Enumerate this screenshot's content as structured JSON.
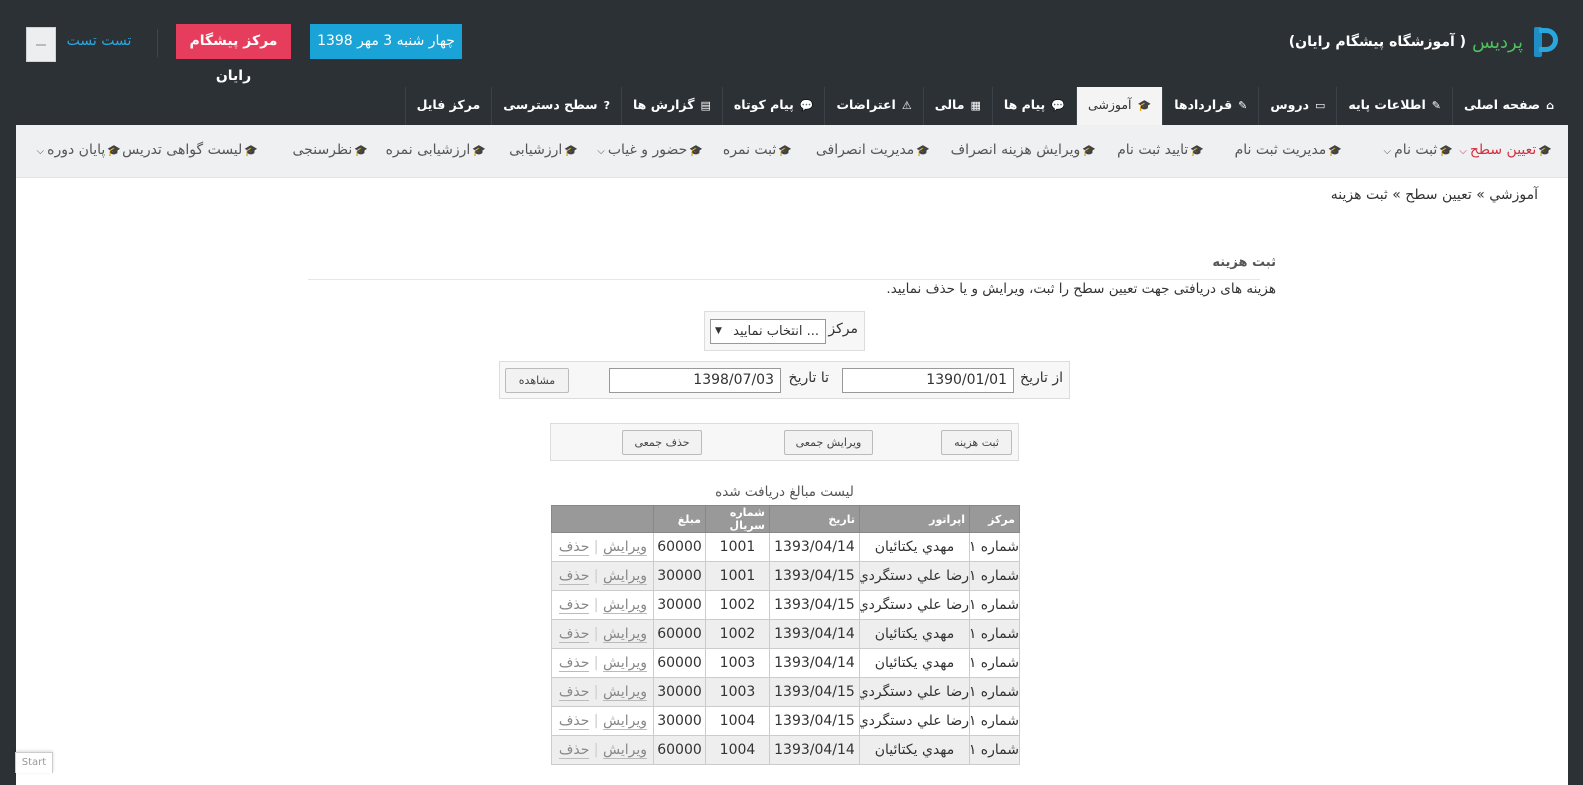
{
  "header": {
    "brand": "پردیس",
    "subtitle": "( آموزشگاه پیشگام رایان)",
    "date": "چهار شنبه 3 مهر 1398",
    "center": "مرکز پیشگام رایان",
    "user": "تست تست"
  },
  "main_tabs": [
    {
      "label": "صفحه اصلی",
      "icon": "home-icon",
      "glyph": "⌂"
    },
    {
      "label": "اطلاعات پایه",
      "icon": "wrench-icon",
      "glyph": "✎"
    },
    {
      "label": "دروس",
      "icon": "folder-icon",
      "glyph": "▭"
    },
    {
      "label": "قراردادها",
      "icon": "edit-icon",
      "glyph": "✎"
    },
    {
      "label": "آموزشی",
      "icon": "graduation-cap-icon",
      "glyph": "🎓"
    },
    {
      "label": "پیام ها",
      "icon": "comments-icon",
      "glyph": "💬"
    },
    {
      "label": "مالی",
      "icon": "calculator-icon",
      "glyph": "▦"
    },
    {
      "label": "اعتراضات",
      "icon": "warning-icon",
      "glyph": "⚠"
    },
    {
      "label": "پیام کوتاه",
      "icon": "comment-icon",
      "glyph": "💬"
    },
    {
      "label": "گزارش ها",
      "icon": "file-icon",
      "glyph": "▤"
    },
    {
      "label": "سطح دسترسی",
      "icon": "question-icon",
      "glyph": "?"
    },
    {
      "label": "مرکز فایل",
      "icon": "",
      "glyph": ""
    }
  ],
  "sub_menu": [
    {
      "label": "تعیین سطح",
      "current": true,
      "dropdown": true
    },
    {
      "label": "ثبت نام",
      "dropdown": true
    },
    {
      "label": "مدیریت ثبت نام"
    },
    {
      "label": "تایید ثبت نام"
    },
    {
      "label": "ویرایش هزینه انصراف"
    },
    {
      "label": "مدیریت انصرافی"
    },
    {
      "label": "ثبت نمره"
    },
    {
      "label": "حضور و غیاب",
      "dropdown": true
    },
    {
      "label": "ارزشیابی"
    },
    {
      "label": "ارزشیابی نمره"
    },
    {
      "label": "نظرسنجی"
    },
    {
      "label": "لیست گواهی تدریس"
    },
    {
      "label": "پایان دوره",
      "dropdown": true
    }
  ],
  "breadcrumb": "آموزشي » تعیین سطح » ثبت هزینه",
  "section": {
    "title": "ثبت هزینه",
    "description": "هزینه های دریافتی جهت تعیین سطح را ثبت، ویرایش و یا حذف نمایید."
  },
  "filter": {
    "center_label": "مرکز",
    "center_value": "انتخاب نمایید ...",
    "from_label": "از تاریخ",
    "from_value": "1390/01/01",
    "to_label": "تا تاریخ",
    "to_value": "1398/07/03",
    "view_button": "مشاهده"
  },
  "actions": {
    "add": "ثبت هزینه",
    "bulk_edit": "ویرایش جمعی",
    "bulk_delete": "حذف جمعی"
  },
  "list": {
    "title": "لیست مبالغ دریافت شده",
    "columns": [
      "مرکز",
      "اپراتور",
      "تاریخ",
      "شماره سریال",
      "مبلغ"
    ],
    "edit_label": "ویرایش",
    "delete_label": "حذف",
    "rows": [
      [
        "شماره ۱",
        "مهدي يكتائيان",
        "1393/04/14",
        "1001",
        "60000"
      ],
      [
        "شماره ۱",
        "رضا علي دستگردي",
        "1393/04/15",
        "1001",
        "30000"
      ],
      [
        "شماره ۱",
        "رضا علي دستگردي",
        "1393/04/15",
        "1002",
        "30000"
      ],
      [
        "شماره ۱",
        "مهدي يكتائيان",
        "1393/04/14",
        "1002",
        "60000"
      ],
      [
        "شماره ۱",
        "مهدي يكتائيان",
        "1393/04/14",
        "1003",
        "60000"
      ],
      [
        "شماره ۱",
        "رضا علي دستگردي",
        "1393/04/15",
        "1003",
        "30000"
      ],
      [
        "شماره ۱",
        "رضا علي دستگردي",
        "1393/04/15",
        "1004",
        "30000"
      ],
      [
        "شماره ۱",
        "مهدي يكتائيان",
        "1393/04/14",
        "1004",
        "60000"
      ]
    ]
  },
  "footer": {
    "start": "Start"
  }
}
